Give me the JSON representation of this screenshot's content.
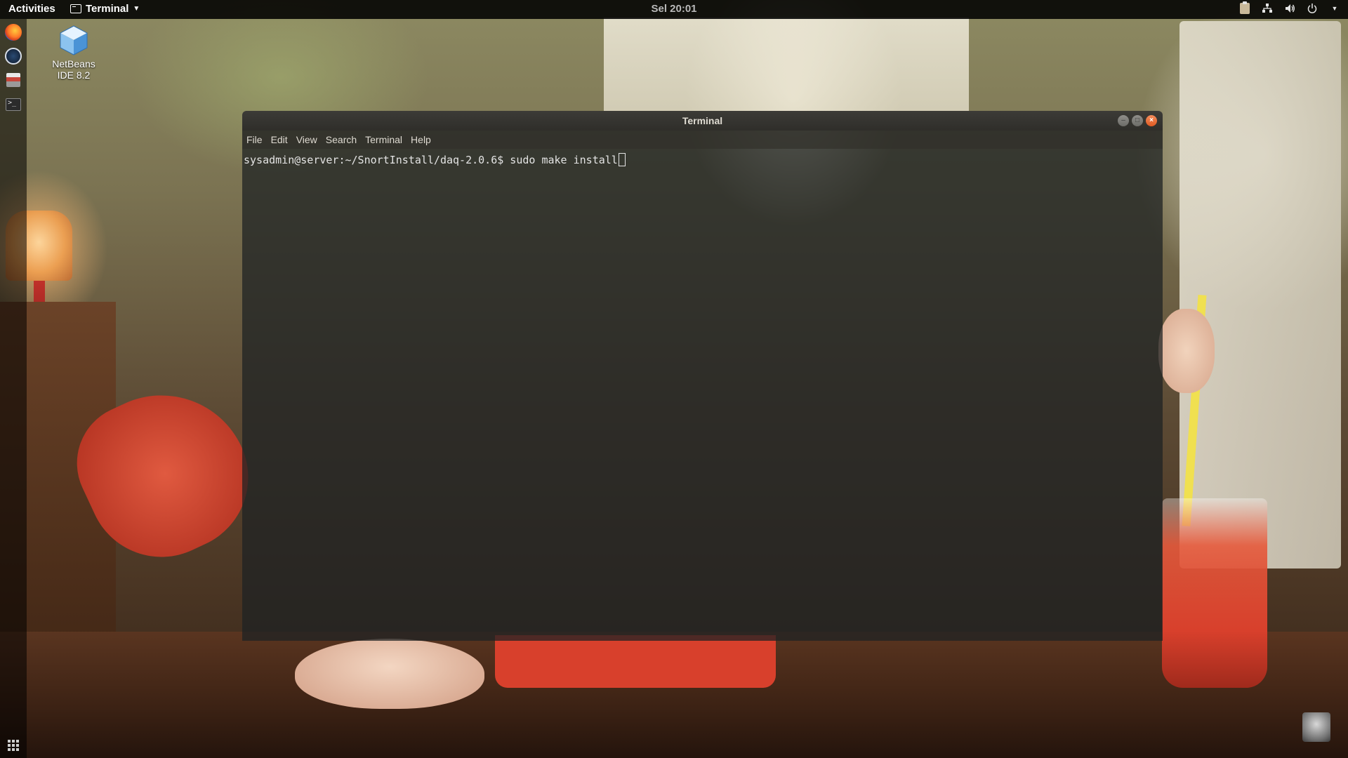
{
  "topbar": {
    "activities": "Activities",
    "app_name": "Terminal",
    "clock": "Sel 20:01"
  },
  "dock": {
    "items": [
      "firefox-icon",
      "steam-icon",
      "files-icon",
      "terminal-icon"
    ],
    "show_apps": "apps-grid-icon"
  },
  "desktop": {
    "icon_label_line1": "NetBeans",
    "icon_label_line2": "IDE 8.2"
  },
  "terminal": {
    "title": "Terminal",
    "menu": [
      "File",
      "Edit",
      "View",
      "Search",
      "Terminal",
      "Help"
    ],
    "prompt": "sysadmin@server:~/SnortInstall/daq-2.0.6$ ",
    "command": "sudo make install"
  },
  "colors": {
    "topbar_bg": "#000000",
    "terminal_bg": "#1e2223",
    "close_button": "#e05a22",
    "text": "#e4e4e4"
  }
}
